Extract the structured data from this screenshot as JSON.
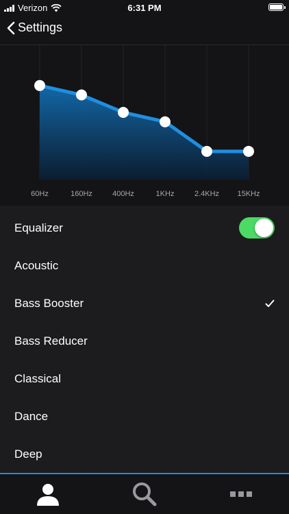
{
  "status_bar": {
    "carrier": "Verizon",
    "time": "6:31 PM"
  },
  "nav": {
    "back_label": "Settings"
  },
  "equalizer": {
    "bands": [
      "60Hz",
      "160Hz",
      "400Hz",
      "1KHz",
      "2.4KHz",
      "15KHz"
    ],
    "levels": [
      0.7,
      0.63,
      0.5,
      0.43,
      0.21,
      0.21
    ],
    "accent_color": "#1e8fe0"
  },
  "list": {
    "equalizer_label": "Equalizer",
    "equalizer_enabled": true,
    "presets": [
      {
        "label": "Acoustic",
        "selected": false
      },
      {
        "label": "Bass Booster",
        "selected": true
      },
      {
        "label": "Bass Reducer",
        "selected": false
      },
      {
        "label": "Classical",
        "selected": false
      },
      {
        "label": "Dance",
        "selected": false
      },
      {
        "label": "Deep",
        "selected": false
      }
    ]
  },
  "tab_bar": {
    "tabs": [
      {
        "icon": "person-icon",
        "active": true
      },
      {
        "icon": "search-icon",
        "active": false
      },
      {
        "icon": "more-icon",
        "active": false
      }
    ]
  },
  "colors": {
    "toggle_on": "#4cd964",
    "background": "#1c1c1e"
  }
}
